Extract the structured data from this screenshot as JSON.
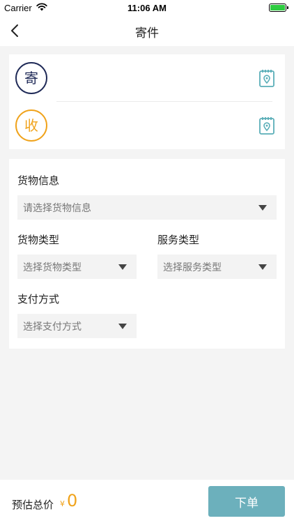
{
  "status_bar": {
    "carrier": "Carrier",
    "time": "11:06 AM"
  },
  "nav": {
    "title": "寄件"
  },
  "address": {
    "sender_badge": "寄",
    "receiver_badge": "收"
  },
  "form": {
    "goods_info_label": "货物信息",
    "goods_info_placeholder": "请选择货物信息",
    "goods_type_label": "货物类型",
    "goods_type_placeholder": "选择货物类型",
    "service_type_label": "服务类型",
    "service_type_placeholder": "选择服务类型",
    "payment_label": "支付方式",
    "payment_placeholder": "选择支付方式"
  },
  "footer": {
    "estimate_label": "预估总价",
    "currency": "¥",
    "price": "0",
    "submit_label": "下单"
  },
  "colors": {
    "accent": "#6cb0bc",
    "sender": "#1f2a57",
    "receiver": "#f0a31c",
    "price": "#f0a31c"
  }
}
